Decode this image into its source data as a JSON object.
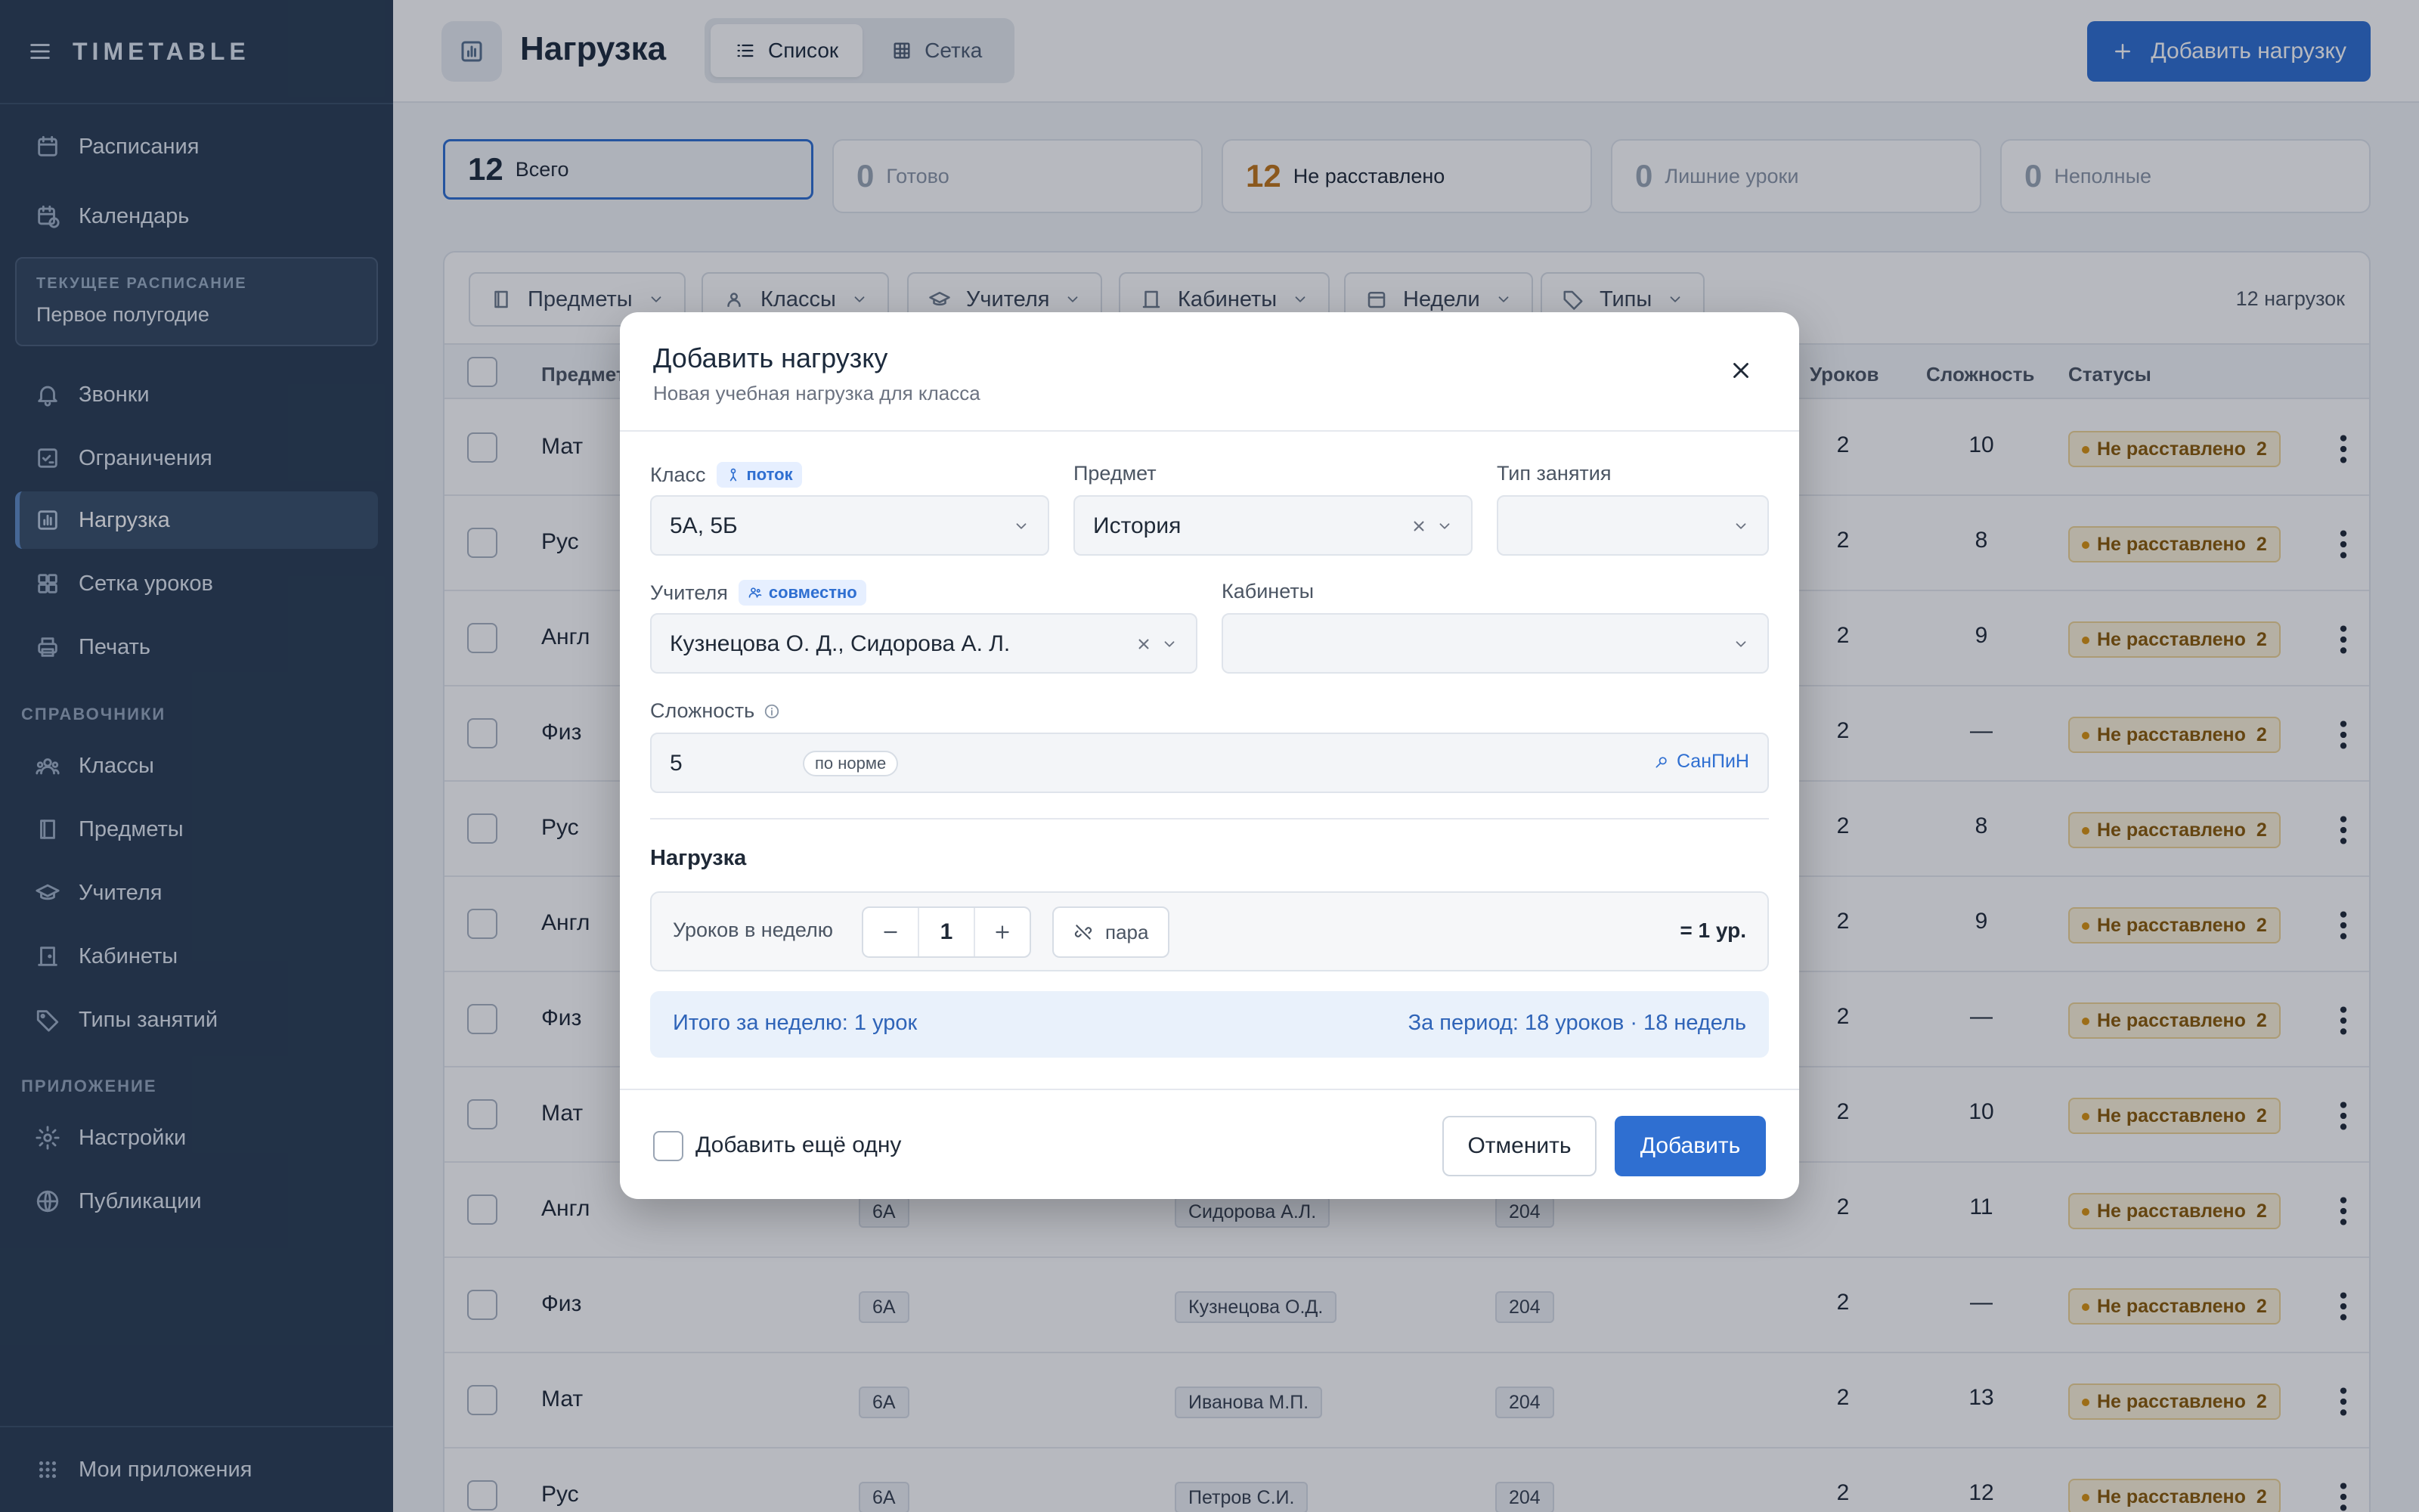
{
  "sidebar": {
    "brand": "TIMETABLE",
    "top_items": [
      {
        "label": "Расписания"
      },
      {
        "label": "Календарь"
      }
    ],
    "current": {
      "label": "ТЕКУЩЕЕ РАСПИСАНИЕ",
      "value": "Первое полугодие"
    },
    "main_items": [
      {
        "label": "Звонки"
      },
      {
        "label": "Ограничения"
      },
      {
        "label": "Нагрузка"
      },
      {
        "label": "Сетка уроков"
      },
      {
        "label": "Печать"
      }
    ],
    "section_ref": "СПРАВОЧНИКИ",
    "ref_items": [
      {
        "label": "Классы"
      },
      {
        "label": "Предметы"
      },
      {
        "label": "Учителя"
      },
      {
        "label": "Кабинеты"
      },
      {
        "label": "Типы занятий"
      }
    ],
    "section_app": "ПРИЛОЖЕНИЕ",
    "app_items": [
      {
        "label": "Настройки"
      },
      {
        "label": "Публикации"
      }
    ],
    "footer": "Мои приложения"
  },
  "header": {
    "title": "Нагрузка",
    "view_list": "Список",
    "view_grid": "Сетка",
    "add_button": "Добавить нагрузку"
  },
  "stats": [
    {
      "n": "12",
      "label": "Всего"
    },
    {
      "n": "0",
      "label": "Готово"
    },
    {
      "n": "12",
      "label": "Не расставлено"
    },
    {
      "n": "0",
      "label": "Лишние уроки"
    },
    {
      "n": "0",
      "label": "Неполные"
    }
  ],
  "filters": [
    "Предметы",
    "Классы",
    "Учителя",
    "Кабинеты",
    "Недели",
    "Типы"
  ],
  "count_text": "12 нагрузок",
  "table": {
    "headers": {
      "subject": "Предмет",
      "lessons": "Уроков",
      "complexity": "Сложность",
      "statuses": "Статусы"
    },
    "status_text": "Не расставлено",
    "status_count": "2",
    "rows": [
      {
        "subj": "Мат",
        "cls": "",
        "teacher": "",
        "room": "",
        "lessons": "2",
        "comp": "10"
      },
      {
        "subj": "Рус",
        "cls": "",
        "teacher": "",
        "room": "",
        "lessons": "2",
        "comp": "8"
      },
      {
        "subj": "Англ",
        "cls": "",
        "teacher": "",
        "room": "",
        "lessons": "2",
        "comp": "9"
      },
      {
        "subj": "Физ",
        "cls": "",
        "teacher": "",
        "room": "",
        "lessons": "2",
        "comp": "—"
      },
      {
        "subj": "Рус",
        "cls": "",
        "teacher": "",
        "room": "",
        "lessons": "2",
        "comp": "8"
      },
      {
        "subj": "Англ",
        "cls": "",
        "teacher": "",
        "room": "",
        "lessons": "2",
        "comp": "9"
      },
      {
        "subj": "Физ",
        "cls": "",
        "teacher": "",
        "room": "",
        "lessons": "2",
        "comp": "—"
      },
      {
        "subj": "Мат",
        "cls": "",
        "teacher": "",
        "room": "",
        "lessons": "2",
        "comp": "10"
      },
      {
        "subj": "Англ",
        "cls": "6А",
        "teacher": "Сидорова А.Л.",
        "room": "204",
        "lessons": "2",
        "comp": "11"
      },
      {
        "subj": "Физ",
        "cls": "6А",
        "teacher": "Кузнецова О.Д.",
        "room": "204",
        "lessons": "2",
        "comp": "—"
      },
      {
        "subj": "Мат",
        "cls": "6А",
        "teacher": "Иванова М.П.",
        "room": "204",
        "lessons": "2",
        "comp": "13"
      },
      {
        "subj": "Рус",
        "cls": "6А",
        "teacher": "Петров С.И.",
        "room": "204",
        "lessons": "2",
        "comp": "12"
      }
    ]
  },
  "modal": {
    "title": "Добавить нагрузку",
    "subtitle": "Новая учебная нагрузка для класса",
    "class_label": "Класс",
    "class_tag": "поток",
    "class_value": "5А, 5Б",
    "subject_label": "Предмет",
    "subject_value": "История",
    "type_label": "Тип занятия",
    "teachers_label": "Учителя",
    "teachers_tag": "совместно",
    "teachers_value": "Кузнецова О. Д., Сидорова А. Л.",
    "rooms_label": "Кабинеты",
    "complexity_label": "Сложность",
    "complexity_value": "5",
    "complexity_norm": "по норме",
    "sanpin": "СанПиН",
    "load_heading": "Нагрузка",
    "per_week_label": "Уроков в неделю",
    "per_week_value": "1",
    "pair_label": "пара",
    "per_week_result": "= 1 ур.",
    "total_week": "Итого за неделю: 1 урок",
    "total_period": "За период: 18 уроков · 18 недель",
    "add_another": "Добавить ещё одну",
    "cancel": "Отменить",
    "submit": "Добавить"
  },
  "colors": {
    "accent": "#2f6fd1",
    "sidebar": "#2a3d54",
    "warning": "#c07418"
  }
}
